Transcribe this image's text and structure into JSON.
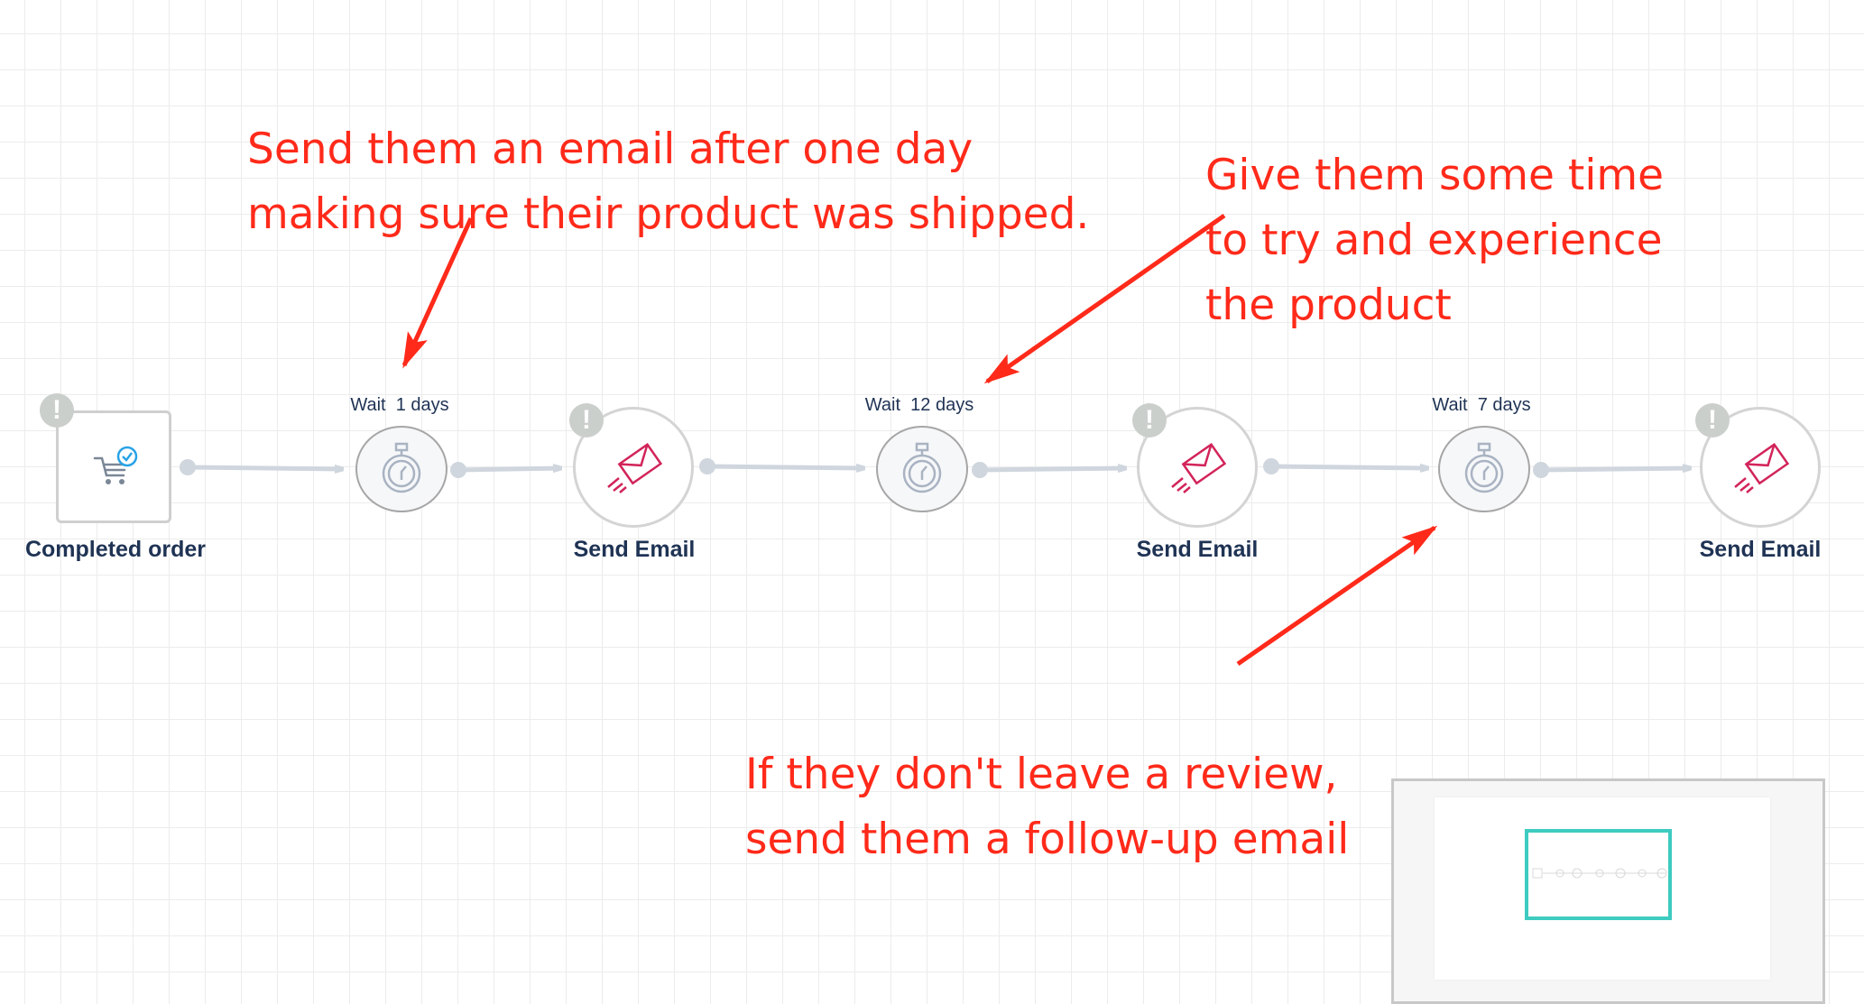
{
  "workflow": {
    "trigger": {
      "label": "Completed order",
      "icon": "cart-check-icon",
      "warning": true
    },
    "steps": [
      {
        "type": "wait",
        "label": "Wait  1 days",
        "icon": "stopwatch-icon"
      },
      {
        "type": "email",
        "label": "Send Email",
        "icon": "send-email-icon",
        "warning": true
      },
      {
        "type": "wait",
        "label": "Wait  12 days",
        "icon": "stopwatch-icon"
      },
      {
        "type": "email",
        "label": "Send Email",
        "icon": "send-email-icon",
        "warning": true
      },
      {
        "type": "wait",
        "label": "Wait  7 days",
        "icon": "stopwatch-icon"
      },
      {
        "type": "email",
        "label": "Send Email",
        "icon": "send-email-icon",
        "warning": true
      }
    ],
    "warning_glyph": "!"
  },
  "annotations": [
    {
      "text": "Send them an email after one day\nmaking sure their product was shipped."
    },
    {
      "text": "Give them some time\nto try and experience\nthe product"
    },
    {
      "text": "If they don't leave a review,\nsend them a follow-up email"
    }
  ],
  "colors": {
    "annotation": "#ff2a1a",
    "minimap_viewport": "#3ecbc0",
    "label": "#1f3354",
    "email_icon": "#d2245a",
    "cart_check": "#2aa3e6"
  }
}
